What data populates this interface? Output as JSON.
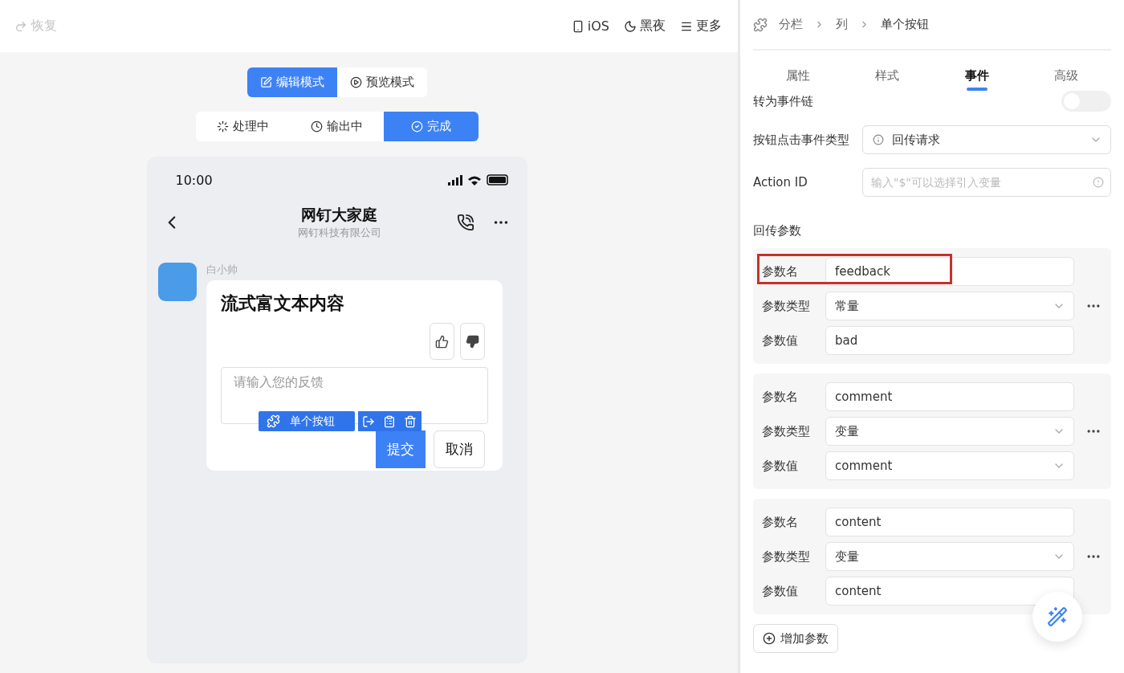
{
  "toolbar": {
    "redo": {
      "label": "恢复",
      "disabled": true
    },
    "actions": [
      {
        "kind": "phone",
        "label": "iOS"
      },
      {
        "kind": "moon",
        "label": "黑夜"
      },
      {
        "kind": "menu",
        "label": "更多"
      }
    ]
  },
  "modes": [
    {
      "kind": "edit",
      "label": "编辑模式",
      "selected": true
    },
    {
      "kind": "play",
      "label": "预览模式",
      "selected": false
    }
  ],
  "statuses": [
    {
      "kind": "spinner",
      "label": "处理中",
      "selected": false
    },
    {
      "kind": "clock",
      "label": "输出中",
      "selected": false
    },
    {
      "kind": "check",
      "label": "完成",
      "selected": true
    }
  ],
  "phone": {
    "time": "10:00",
    "chat_title": "网钉大家庭",
    "chat_subtitle": "网钉科技有限公司",
    "sender": "白小帅",
    "card": {
      "title": "流式富文本内容",
      "feedback_placeholder": "请输入您的反馈",
      "selection_tag": "单个按钮",
      "buttons": [
        {
          "label": "提交",
          "selected": true
        },
        {
          "label": "取消",
          "selected": false
        }
      ]
    }
  },
  "panel": {
    "breadcrumb": [
      "分栏",
      "列",
      "单个按钮"
    ],
    "tabs": [
      {
        "label": "属性",
        "selected": false
      },
      {
        "label": "样式",
        "selected": false
      },
      {
        "label": "事件",
        "selected": true
      },
      {
        "label": "高级",
        "selected": false
      }
    ],
    "event_chain": {
      "label": "转为事件链",
      "on": false
    },
    "event_type": {
      "label": "按钮点击事件类型",
      "value": "回传请求"
    },
    "action_id": {
      "label": "Action ID",
      "placeholder": "输入\"$\"可以选择引入变量"
    },
    "params_title": "回传参数",
    "params": [
      {
        "highlighted": true,
        "name_label": "参数名",
        "name": "feedback",
        "type_label": "参数类型",
        "type": "常量",
        "value_label": "参数值",
        "value": "bad",
        "value_dropdown": false
      },
      {
        "highlighted": false,
        "name_label": "参数名",
        "name": "comment",
        "type_label": "参数类型",
        "type": "变量",
        "value_label": "参数值",
        "value": "comment",
        "value_dropdown": true
      },
      {
        "highlighted": false,
        "name_label": "参数名",
        "name": "content",
        "type_label": "参数类型",
        "type": "变量",
        "value_label": "参数值",
        "value": "content",
        "value_dropdown": false
      }
    ],
    "add_button": "增加参数"
  }
}
